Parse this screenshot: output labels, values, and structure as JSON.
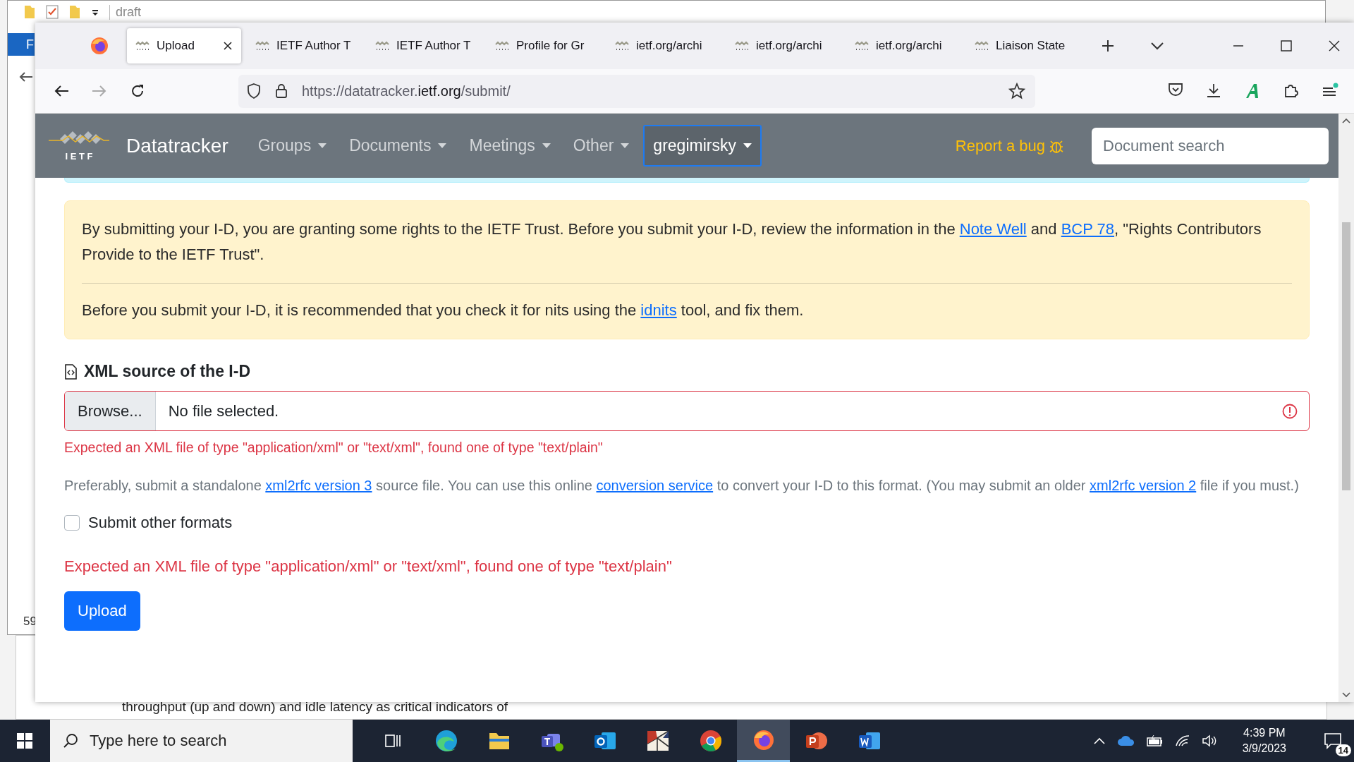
{
  "background_window": {
    "title": "draft",
    "menu_letter": "F",
    "status_text": "59",
    "document_line": "throughput (up and down) and idle latency as critical indicators of"
  },
  "browser": {
    "tabs": [
      {
        "label": "Upload",
        "selected": true
      },
      {
        "label": "IETF Author T",
        "selected": false
      },
      {
        "label": "IETF Author T",
        "selected": false
      },
      {
        "label": "Profile for Gr",
        "selected": false
      },
      {
        "label": "ietf.org/archi",
        "selected": false
      },
      {
        "label": "ietf.org/archi",
        "selected": false
      },
      {
        "label": "ietf.org/archi",
        "selected": false
      },
      {
        "label": "Liaison State",
        "selected": false
      }
    ],
    "url": {
      "prefix": "https://datatracker.",
      "domain": "ietf.org",
      "path": "/submit/"
    }
  },
  "site_header": {
    "logo_text": "I E T F",
    "brand": "Datatracker",
    "nav": [
      {
        "label": "Groups",
        "selected": false
      },
      {
        "label": "Documents",
        "selected": false
      },
      {
        "label": "Meetings",
        "selected": false
      },
      {
        "label": "Other",
        "selected": false
      },
      {
        "label": "gregimirsky",
        "selected": true
      }
    ],
    "report_bug": "Report a bug",
    "search": {
      "placeholder": "Document search"
    }
  },
  "notice": {
    "paragraphs": [
      [
        {
          "kind": "text",
          "text": "By submitting your I-D, you are granting some rights to the IETF Trust. Before you submit your I-D, review the information in the "
        },
        {
          "kind": "link",
          "text": "Note Well"
        },
        {
          "kind": "text",
          "text": " and "
        },
        {
          "kind": "link",
          "text": "BCP 78"
        },
        {
          "kind": "text",
          "text": ", \"Rights Contributors Provide to the IETF Trust\"."
        }
      ],
      [
        {
          "kind": "text",
          "text": "Before you submit your I-D, it is recommended that you check it for nits using the "
        },
        {
          "kind": "link",
          "text": "idnits"
        },
        {
          "kind": "text",
          "text": " tool, and fix them."
        }
      ]
    ]
  },
  "form": {
    "heading": "XML source of the I-D",
    "browse": "Browse...",
    "file_status": "No file selected.",
    "invalid": true,
    "error": "Expected an XML file of type \"application/xml\" or \"text/xml\", found one of type \"text/plain\"",
    "help": [
      {
        "kind": "text",
        "text": "Preferably, submit a standalone "
      },
      {
        "kind": "link",
        "text": "xml2rfc version 3"
      },
      {
        "kind": "text",
        "text": " source file. You can use this online "
      },
      {
        "kind": "link",
        "text": "conversion service"
      },
      {
        "kind": "text",
        "text": " to convert your I-D to this format. (You may submit an older "
      },
      {
        "kind": "link",
        "text": "xml2rfc version 2"
      },
      {
        "kind": "text",
        "text": " file if you must.)"
      }
    ],
    "other_formats": {
      "label": "Submit other formats",
      "checked": false
    },
    "error_bottom": "Expected an XML file of type \"application/xml\" or \"text/xml\", found one of type \"text/plain\"",
    "submit": "Upload"
  },
  "taskbar": {
    "search_placeholder": "Type here to search",
    "apps": [
      {
        "kind": "taskview",
        "selected": false
      },
      {
        "kind": "edge",
        "selected": false
      },
      {
        "kind": "folder",
        "selected": false
      },
      {
        "kind": "teams",
        "selected": false
      },
      {
        "kind": "outlook",
        "selected": false
      },
      {
        "kind": "mosaic",
        "selected": false
      },
      {
        "kind": "chrome",
        "selected": false
      },
      {
        "kind": "firefox",
        "selected": true
      },
      {
        "kind": "powerpoint",
        "selected": false
      },
      {
        "kind": "word",
        "selected": false
      }
    ],
    "time": "4:39 PM",
    "date": "3/9/2023",
    "notifications": "14"
  }
}
